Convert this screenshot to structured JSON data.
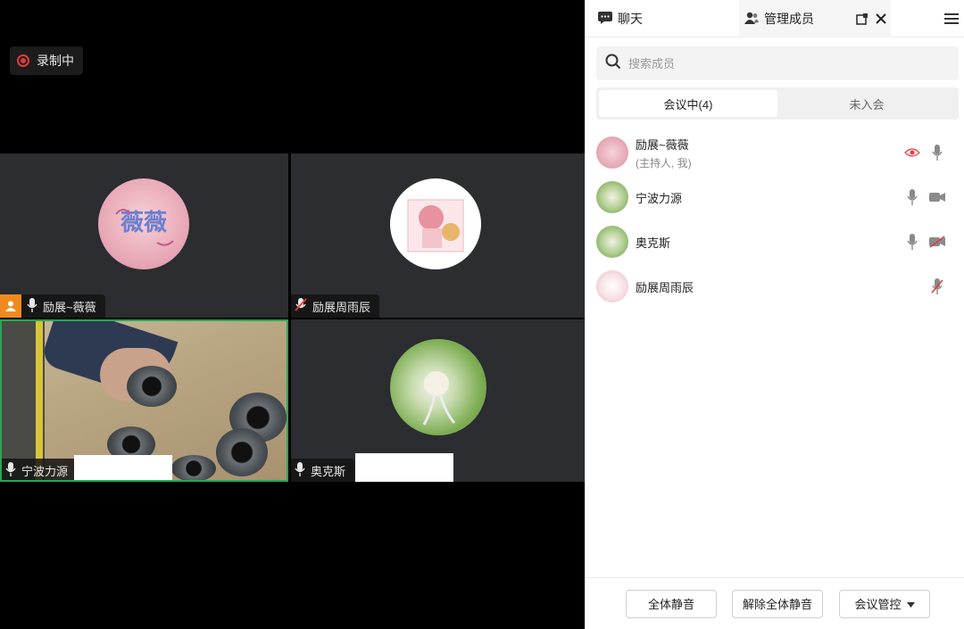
{
  "recording": {
    "label": "录制中"
  },
  "videos": [
    {
      "name": "励展~薇薇",
      "host": true,
      "mic": "on"
    },
    {
      "name": "励展周雨辰",
      "host": false,
      "mic": "muted"
    },
    {
      "name": "宁波力源",
      "host": false,
      "mic": "on",
      "active_speaker": true
    },
    {
      "name": "奥克斯",
      "host": false,
      "mic": "on"
    }
  ],
  "panel": {
    "tabs": {
      "chat": "聊天",
      "members": "管理成员"
    },
    "search": {
      "placeholder": "搜索成员"
    },
    "segments": {
      "in_meeting": "会议中(4)",
      "not_joined": "未入会"
    },
    "members": [
      {
        "name": "励展~薇薇",
        "sub": "(主持人, 我)",
        "icons": [
          "recording-icon",
          "mic-icon"
        ]
      },
      {
        "name": "宁波力源",
        "sub": "",
        "icons": [
          "mic-icon",
          "camera-icon"
        ]
      },
      {
        "name": "奥克斯",
        "sub": "",
        "icons": [
          "mic-icon",
          "camera-off-icon"
        ]
      },
      {
        "name": "励展周雨辰",
        "sub": "",
        "icons": [
          "mic-muted-icon"
        ]
      }
    ],
    "footer": {
      "mute_all": "全体静音",
      "unmute_all": "解除全体静音",
      "controls": "会议管控"
    }
  },
  "colors": {
    "recording": "#e23b3b",
    "host_badge": "#f08a1d",
    "active_speaker": "#2aa654"
  }
}
